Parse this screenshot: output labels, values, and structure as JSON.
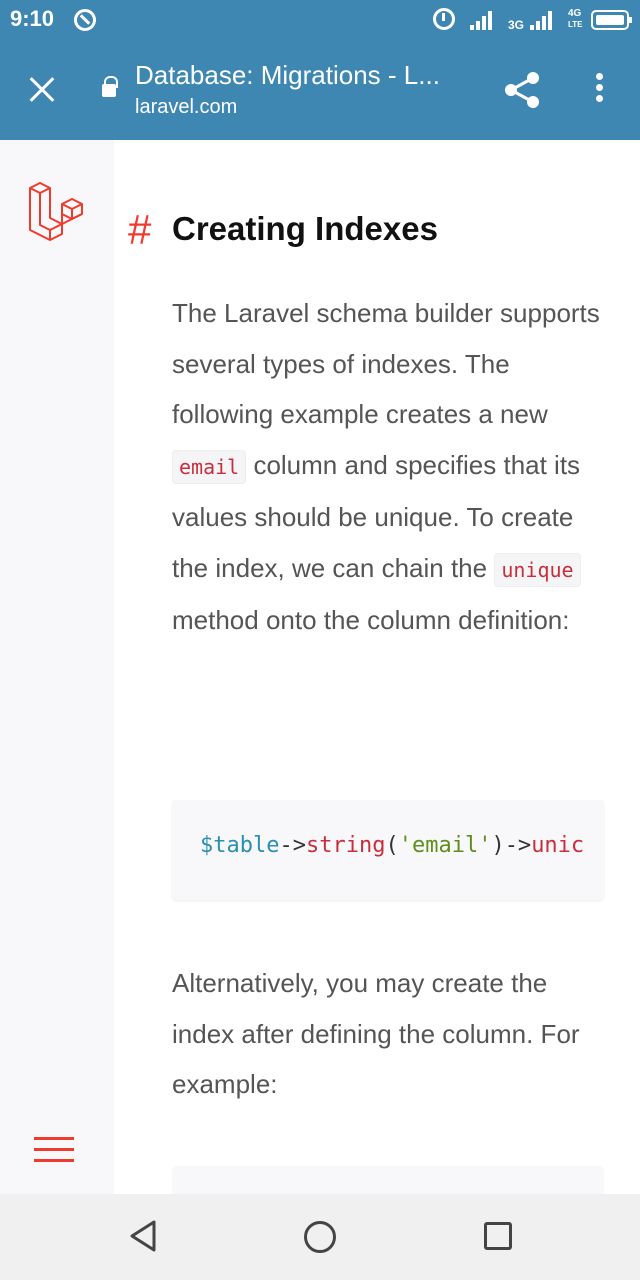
{
  "status_bar": {
    "time": "9:10",
    "network_1": "3G",
    "network_2": "4G",
    "network_2_sub": "LTE"
  },
  "browser": {
    "page_title": "Database: Migrations - L...",
    "page_domain": "laravel.com"
  },
  "article": {
    "heading_anchor": "#",
    "heading": "Creating Indexes",
    "para1_a": "The Laravel schema builder supports several types of indexes. The following example creates a new ",
    "para1_code1": "email",
    "para1_b": " column and specifies that its values should be unique. To create the index, we can chain the ",
    "para1_code2": "unique",
    "para1_c": " method onto the column definition:",
    "code": {
      "var": "$table",
      "arrow1": "->",
      "method1": "string",
      "paren_open": "(",
      "string_arg": "'email'",
      "paren_close": ")",
      "arrow2": "->",
      "method2": "unic"
    },
    "para2": "Alternatively, you may create the index after defining the column. For example:"
  },
  "colors": {
    "toolbar": "#3f87b3",
    "laravel_red": "#ef3b2d",
    "code_var": "#2a8fb0",
    "code_method": "#c7303b",
    "code_string": "#5f8f1a",
    "code_punct": "#333333"
  },
  "icons": {
    "close": "close-icon",
    "lock": "lock-icon",
    "share": "share-icon",
    "menu": "more-vert-icon",
    "logo": "laravel-logo-icon",
    "hamburger": "hamburger-menu-icon",
    "back": "nav-back-icon",
    "home": "nav-home-icon",
    "recents": "nav-recents-icon"
  }
}
